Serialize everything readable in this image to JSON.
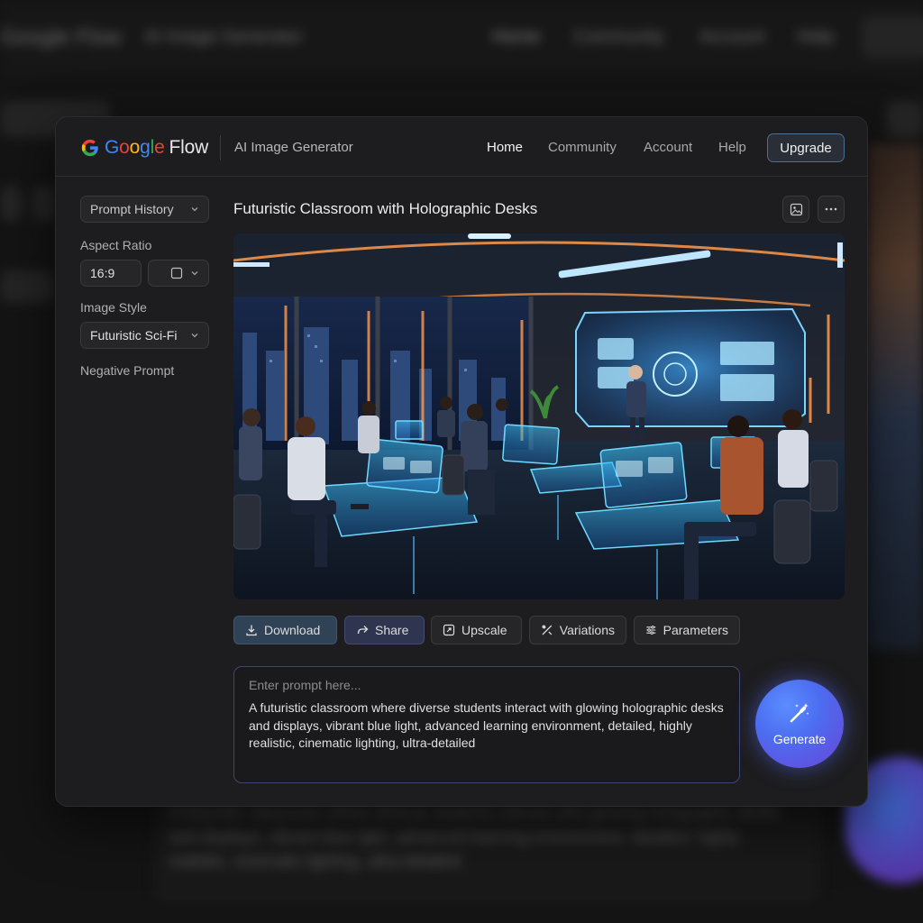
{
  "app": {
    "brand_word": "Google",
    "brand_suffix": "Flow",
    "subtitle": "AI Image Generator"
  },
  "nav": {
    "items": [
      "Home",
      "Community",
      "Account",
      "Help"
    ],
    "active": "Home",
    "upgrade_label": "Upgrade"
  },
  "sidebar": {
    "prompt_history_label": "Prompt History",
    "aspect_ratio_label": "Aspect Ratio",
    "aspect_ratio_value": "16:9",
    "image_style_label": "Image Style",
    "image_style_value": "Futuristic Sci-Fi",
    "negative_prompt_label": "Negative Prompt"
  },
  "main": {
    "image_title": "Futuristic Classroom with Holographic Desks",
    "actions": {
      "download": "Download",
      "share": "Share",
      "upscale": "Upscale",
      "variations": "Variations",
      "parameters": "Parameters"
    },
    "prompt": {
      "placeholder": "Enter prompt here...",
      "value": "A futuristic classroom where diverse students interact with glowing holographic desks and displays, vibrant blue light, advanced learning environment, detailed, highly realistic, cinematic lighting, ultra-detailed"
    },
    "generate_label": "Generate"
  },
  "colors": {
    "accent_blue": "#4c6df0",
    "accent_purple": "#6a44d6",
    "upgrade_border": "#4d6c96",
    "prompt_border": "#3e4677"
  },
  "icons": [
    "google-g-icon",
    "chevron-down-icon",
    "square-icon",
    "image-icon",
    "more-icon",
    "download-icon",
    "share-icon",
    "upscale-icon",
    "variations-icon",
    "parameters-icon",
    "magic-wand-icon"
  ]
}
